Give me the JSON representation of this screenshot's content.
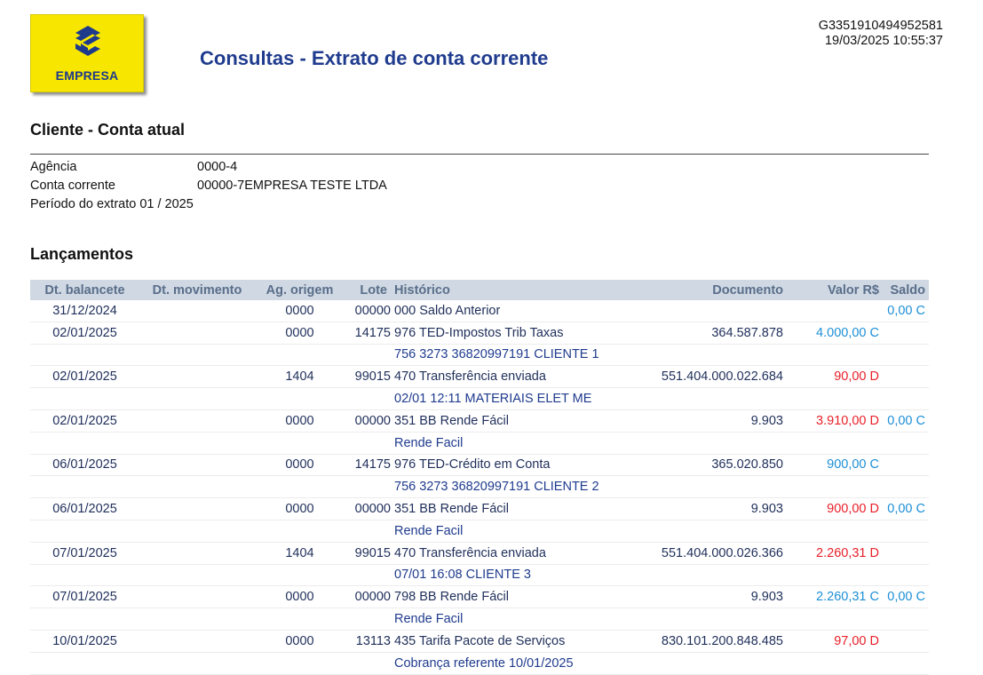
{
  "logo": {
    "text": "EMPRESA",
    "color": "#f7e700"
  },
  "header": {
    "title": "Consultas - Extrato de conta corrente",
    "code": "G3351910494952581",
    "datetime": "19/03/2025 10:55:37"
  },
  "cliente": {
    "section_title": "Cliente - Conta atual",
    "fields": [
      {
        "label": "Agência",
        "value": "0000-4"
      },
      {
        "label": "Conta corrente",
        "value": "00000-7EMPRESA TESTE LTDA"
      },
      {
        "label": "Período do extrato",
        "value": "01 / 2025"
      }
    ]
  },
  "lancamentos": {
    "section_title": "Lançamentos",
    "columns": [
      "Dt. balancete",
      "Dt. movimento",
      "Ag. origem",
      "Lote",
      "Histórico",
      "Documento",
      "Valor R$",
      "Saldo"
    ],
    "rows": [
      {
        "dt_balancete": "31/12/2024",
        "dt_movimento": "",
        "ag_origem": "0000",
        "lote": "00000",
        "historico": "000 Saldo Anterior",
        "documento": "",
        "valor": "",
        "valor_type": "",
        "saldo": "0,00 C",
        "detail": null
      },
      {
        "dt_balancete": "02/01/2025",
        "dt_movimento": "",
        "ag_origem": "0000",
        "lote": "14175",
        "historico": "976 TED-Impostos Trib Taxas",
        "documento": "364.587.878",
        "valor": "4.000,00 C",
        "valor_type": "credit",
        "saldo": "",
        "detail": "756 3273 36820997191 CLIENTE 1"
      },
      {
        "dt_balancete": "02/01/2025",
        "dt_movimento": "",
        "ag_origem": "1404",
        "lote": "99015",
        "historico": "470 Transferência enviada",
        "documento": "551.404.000.022.684",
        "valor": "90,00 D",
        "valor_type": "debit",
        "saldo": "",
        "detail": "02/01 12:11  MATERIAIS ELET ME"
      },
      {
        "dt_balancete": "02/01/2025",
        "dt_movimento": "",
        "ag_origem": "0000",
        "lote": "00000",
        "historico": "351 BB Rende Fácil",
        "documento": "9.903",
        "valor": "3.910,00 D",
        "valor_type": "debit",
        "saldo": "0,00 C",
        "detail": "Rende Facil"
      },
      {
        "dt_balancete": "06/01/2025",
        "dt_movimento": "",
        "ag_origem": "0000",
        "lote": "14175",
        "historico": "976 TED-Crédito em Conta",
        "documento": "365.020.850",
        "valor": "900,00 C",
        "valor_type": "credit",
        "saldo": "",
        "detail": "756 3273 36820997191 CLIENTE 2"
      },
      {
        "dt_balancete": "06/01/2025",
        "dt_movimento": "",
        "ag_origem": "0000",
        "lote": "00000",
        "historico": "351 BB Rende Fácil",
        "documento": "9.903",
        "valor": "900,00 D",
        "valor_type": "debit",
        "saldo": "0,00 C",
        "detail": "Rende Facil"
      },
      {
        "dt_balancete": "07/01/2025",
        "dt_movimento": "",
        "ag_origem": "1404",
        "lote": "99015",
        "historico": "470 Transferência enviada",
        "documento": "551.404.000.026.366",
        "valor": "2.260,31 D",
        "valor_type": "debit",
        "saldo": "",
        "detail": "07/01 16:08 CLIENTE 3"
      },
      {
        "dt_balancete": "07/01/2025",
        "dt_movimento": "",
        "ag_origem": "0000",
        "lote": "00000",
        "historico": "798 BB Rende Fácil",
        "documento": "9.903",
        "valor": "2.260,31 C",
        "valor_type": "credit",
        "saldo": "0,00 C",
        "detail": "Rende Facil"
      },
      {
        "dt_balancete": "10/01/2025",
        "dt_movimento": "",
        "ag_origem": "0000",
        "lote": "13113",
        "historico": "435 Tarifa Pacote de Serviços",
        "documento": "830.101.200.848.485",
        "valor": "97,00 D",
        "valor_type": "debit",
        "saldo": "",
        "detail": "Cobrança referente 10/01/2025"
      }
    ]
  },
  "colors": {
    "title": "#1f3b8e",
    "header_bg": "#cfd8e3",
    "credit": "#1d8fd6",
    "debit": "#e8202a"
  }
}
